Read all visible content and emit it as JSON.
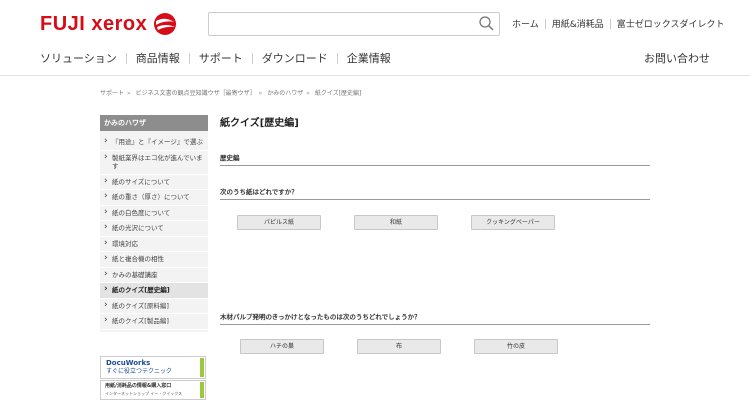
{
  "header": {
    "logo_text": "FUJI xerox",
    "search": {
      "placeholder": "",
      "value": ""
    },
    "links": [
      "ホーム",
      "用紙&消耗品",
      "富士ゼロックスダイレクト"
    ]
  },
  "nav": {
    "items": [
      "ソリューション",
      "商品情報",
      "サポート",
      "ダウンロード",
      "企業情報"
    ],
    "contact": "お問い合わせ"
  },
  "breadcrumb": [
    "サポート",
    "ビジネス文書の観点豆知識ウザ［最寄ウザ］",
    "かみのハワザ",
    "紙クイズ[歴史編]"
  ],
  "sidebar": {
    "title": "かみのハワザ",
    "items": [
      "『用途』と『イメージ』で選ぶ",
      "製紙業界はエコ化が進んでいます",
      "紙のサイズについて",
      "紙の重さ（厚さ）について",
      "紙の白色度について",
      "紙の光沢について",
      "環境対応",
      "紙と複合機の相性",
      "かみの基礎講座",
      "紙のクイズ[歴史編]",
      "紙のクイズ[原料編]",
      "紙のクイズ[製品編]"
    ],
    "active_index": 9
  },
  "banners": {
    "docuworks_line1": "DocuWorks",
    "docuworks_line2": "すぐに役立つテクニック",
    "supplies_line1": "用紙/消耗品の情報&購入窓口",
    "supplies_line2": "インターネットショップ イー・クイックス"
  },
  "main": {
    "title": "紙クイズ[歴史編]",
    "section_heading": "歴史編",
    "q1": {
      "text": "次のうち紙はどれですか？",
      "options": [
        "パピルス紙",
        "和紙",
        "クッキングペーパー"
      ]
    },
    "q2": {
      "text": "木材パルプ発明のきっかけとなったものは次のうちどれでしょうか？",
      "options": [
        "ハチの巣",
        "布",
        "竹の皮"
      ]
    }
  },
  "colors": {
    "brand_red": "#d70c18",
    "banner_green": "#9ac93c",
    "docuworks_blue": "#1a4c9a"
  }
}
